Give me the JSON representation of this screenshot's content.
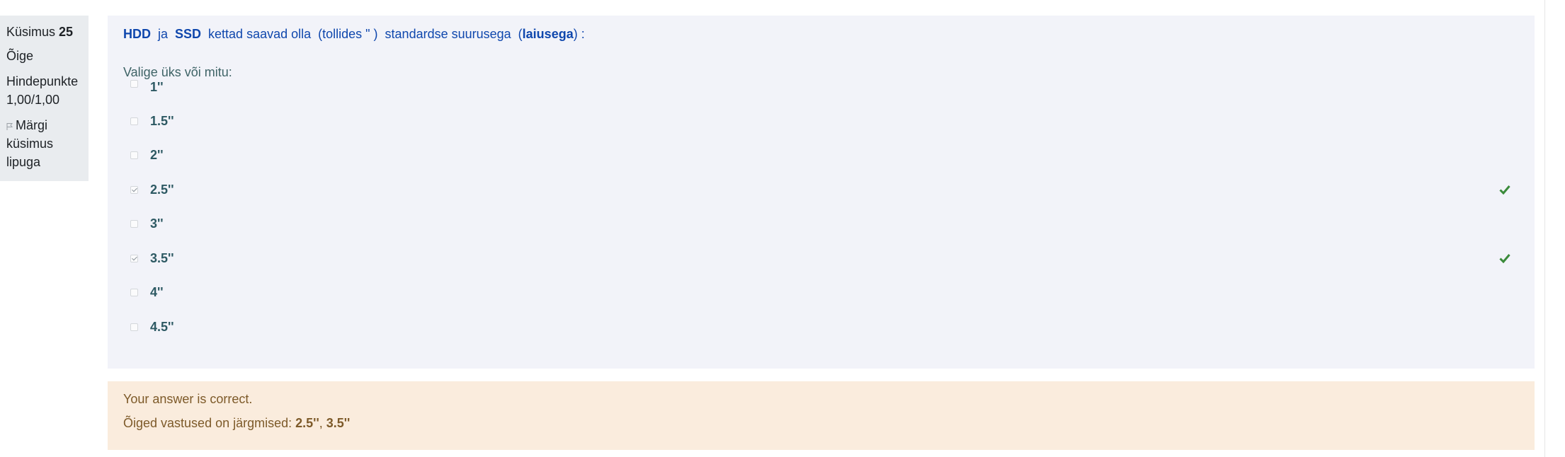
{
  "info": {
    "question_label": "Küsimus",
    "question_number": "25",
    "state": "Õige",
    "grade_label": "Hindepunkte",
    "grade_value": "1,00/1,00",
    "flag_label_1": "Märgi",
    "flag_label_2": "küsimus",
    "flag_label_3": "lipuga",
    "flag_icon": "flag-icon"
  },
  "question": {
    "part_hdd": "HDD",
    "part_ja": "  ja  ",
    "part_ssd": "SSD",
    "part_mid": "  kettad saavad olla  (tollides \" )  standardse suurusega  (",
    "part_laiusega": "laiusega",
    "part_end": ") :",
    "prompt": "Valige üks või mitu:"
  },
  "options": [
    {
      "label": "1''",
      "checked": false,
      "correct": false
    },
    {
      "label": "1.5''",
      "checked": false,
      "correct": false
    },
    {
      "label": "2''",
      "checked": false,
      "correct": false
    },
    {
      "label": "2.5''",
      "checked": true,
      "correct": true
    },
    {
      "label": "3''",
      "checked": false,
      "correct": false
    },
    {
      "label": "3.5''",
      "checked": true,
      "correct": true
    },
    {
      "label": "4''",
      "checked": false,
      "correct": false
    },
    {
      "label": "4.5''",
      "checked": false,
      "correct": false
    }
  ],
  "feedback": {
    "result": "Your answer is correct.",
    "correct_prefix": "Õiged vastused on järgmised: ",
    "correct_a": "2.5''",
    "sep": ", ",
    "correct_b": "3.5''"
  },
  "colors": {
    "tick": "#3a8a3a",
    "feedback_bg": "#faecdd",
    "question_bg": "#f2f3f9"
  }
}
